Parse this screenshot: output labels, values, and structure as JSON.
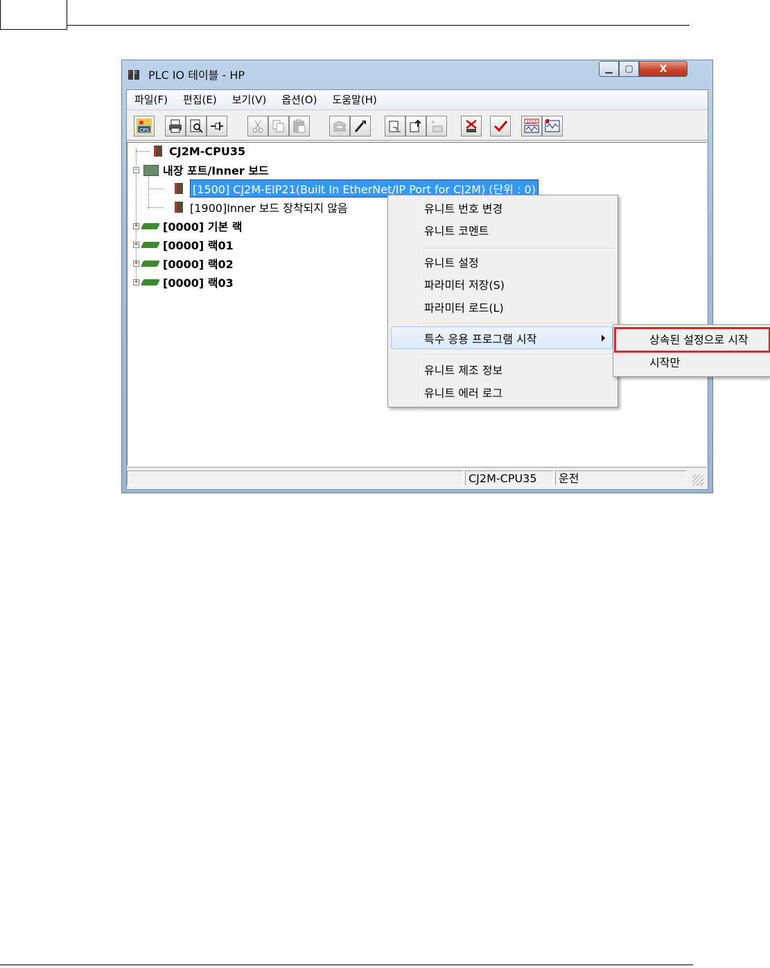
{
  "window": {
    "title": "PLC IO 테이블 - HP",
    "controls": {
      "minimize": "▁",
      "maximize": "▢",
      "close": "X"
    }
  },
  "menubar": {
    "items": [
      "파일(F)",
      "편집(E)",
      "보기(V)",
      "옵션(O)",
      "도움말(H)"
    ]
  },
  "toolbar": {
    "buttons": [
      {
        "icon": "cps-icon",
        "glyph": "⚙"
      },
      {
        "icon": "print-icon",
        "glyph": "⎙"
      },
      {
        "icon": "print-preview-icon",
        "glyph": "🔍"
      },
      {
        "icon": "pin-icon",
        "glyph": "⊣"
      },
      {
        "icon": "cut-icon",
        "glyph": "✂"
      },
      {
        "icon": "copy-icon",
        "glyph": "❐"
      },
      {
        "icon": "paste-icon",
        "glyph": "📋"
      },
      {
        "icon": "unit-icon",
        "glyph": "▤"
      },
      {
        "icon": "tools-icon",
        "glyph": "✎"
      },
      {
        "icon": "upload-icon",
        "glyph": "⇪"
      },
      {
        "icon": "download-icon",
        "glyph": "⇩"
      },
      {
        "icon": "new-unit-icon",
        "glyph": "✱"
      },
      {
        "icon": "delete-icon",
        "glyph": "✗"
      },
      {
        "icon": "check-icon",
        "glyph": "✓"
      },
      {
        "icon": "io-compare-icon",
        "glyph": "≋"
      },
      {
        "icon": "io-verify-icon",
        "glyph": "≈"
      }
    ]
  },
  "tree": {
    "cpu": "CJ2M-CPU35",
    "inner_board": "내장 포트/Inner 보드",
    "eip_unit": "[1500] CJ2M-EIP21(Built In EtherNet/IP Port for CJ2M) (단위 : 0)",
    "inner_unit": "[1900]Inner 보드 장착되지 않음",
    "racks": [
      "[0000] 기본 랙",
      "[0000] 랙01",
      "[0000] 랙02",
      "[0000] 랙03"
    ]
  },
  "statusbar": {
    "model": "CJ2M-CPU35",
    "mode": "운전"
  },
  "context_menu": {
    "items": [
      "유니트 번호 변경",
      "유니트 코멘트",
      "유니트 설정",
      "파라미터 저장(S)",
      "파라미터 로드(L)",
      "특수 응용 프로그램 시작",
      "유니트 제조 정보",
      "유니트 에러 로그"
    ]
  },
  "submenu": {
    "items": [
      "상속된 설정으로 시작",
      "시작만"
    ]
  },
  "colors": {
    "selection": "#3399ff",
    "highlight_box": "#e0262a",
    "rack_green": "#3f8a2e"
  }
}
